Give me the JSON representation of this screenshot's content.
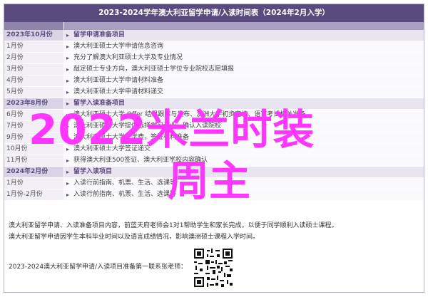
{
  "header": {
    "title": "2023-2024学年澳大利亚留学申请/入读时间表（2024年2月入学）"
  },
  "rows": [
    {
      "kind": "section",
      "time": "2023年10月份",
      "text": "留学申请准备项目"
    },
    {
      "kind": "normal",
      "time": "1月份",
      "text": "澳大利亚硕士大学申请信息咨询"
    },
    {
      "kind": "normal",
      "time": "2月份",
      "text": "充分了解澳大利亚硕士大学及专业情况"
    },
    {
      "kind": "normal",
      "time": "3月份",
      "text": "敲定硕士专业方向，澳大利亚硕士学位专业院校志愿填报"
    },
    {
      "kind": "normal",
      "time": "4月份",
      "text": "澳大利亚硕士大学申请材料准备"
    },
    {
      "kind": "normal",
      "time": "5月份",
      "text": "澳大利亚硕士大学申请材料递交"
    },
    {
      "kind": "section",
      "time": "2023年8月份",
      "text": "留学入读准备项目"
    },
    {
      "kind": "normal",
      "time": "6月份",
      "text": "澳大利亚硕士大学 Offer 结果跟踪与发布、澳洲大学初步定校、语言考试相关准备"
    },
    {
      "kind": "normal",
      "time": "7月份",
      "text": "澳大利亚硕士大学提供选择学习专业、确认入读院校"
    },
    {
      "kind": "normal",
      "time": "9月份",
      "text": "澳大利亚硕士大学交学费，签证材料准备"
    },
    {
      "kind": "normal",
      "time": "10月份",
      "text": "澳大利亚硕士大学签证递交"
    },
    {
      "kind": "normal",
      "time": "11月份",
      "text": "获得澳大利亚500签证、澳大利亚学校内容确认"
    },
    {
      "kind": "section",
      "time": "2024年2月份",
      "text": "留学入读项目"
    },
    {
      "kind": "normal",
      "time": "1月份",
      "text": "入读行前指南、机票、生活、选课等"
    },
    {
      "kind": "normal",
      "time": "1月份-2月份",
      "text": "入读行前指南、机票、生活、选课等"
    }
  ],
  "notes": [
    "澳大利亚留学申请、入读准备项目内容，前蓝天府老师会1对1帮助学生和家长完成，以便于同学顺利入读硕士课程。",
    "澳大利亚留学申请因学生本科毕业时间以及语言成绩情况，影响澳洲硕士课程入学时间。"
  ],
  "footer": {
    "text": "2023-2024澳大利亚留学申请/入读项目准备第一联系张老师："
  },
  "overlay": {
    "line1": "2022米兰时装",
    "line2": "周主"
  },
  "colors": {
    "header": "#5a4b7e",
    "accent": "#ff36ff"
  }
}
